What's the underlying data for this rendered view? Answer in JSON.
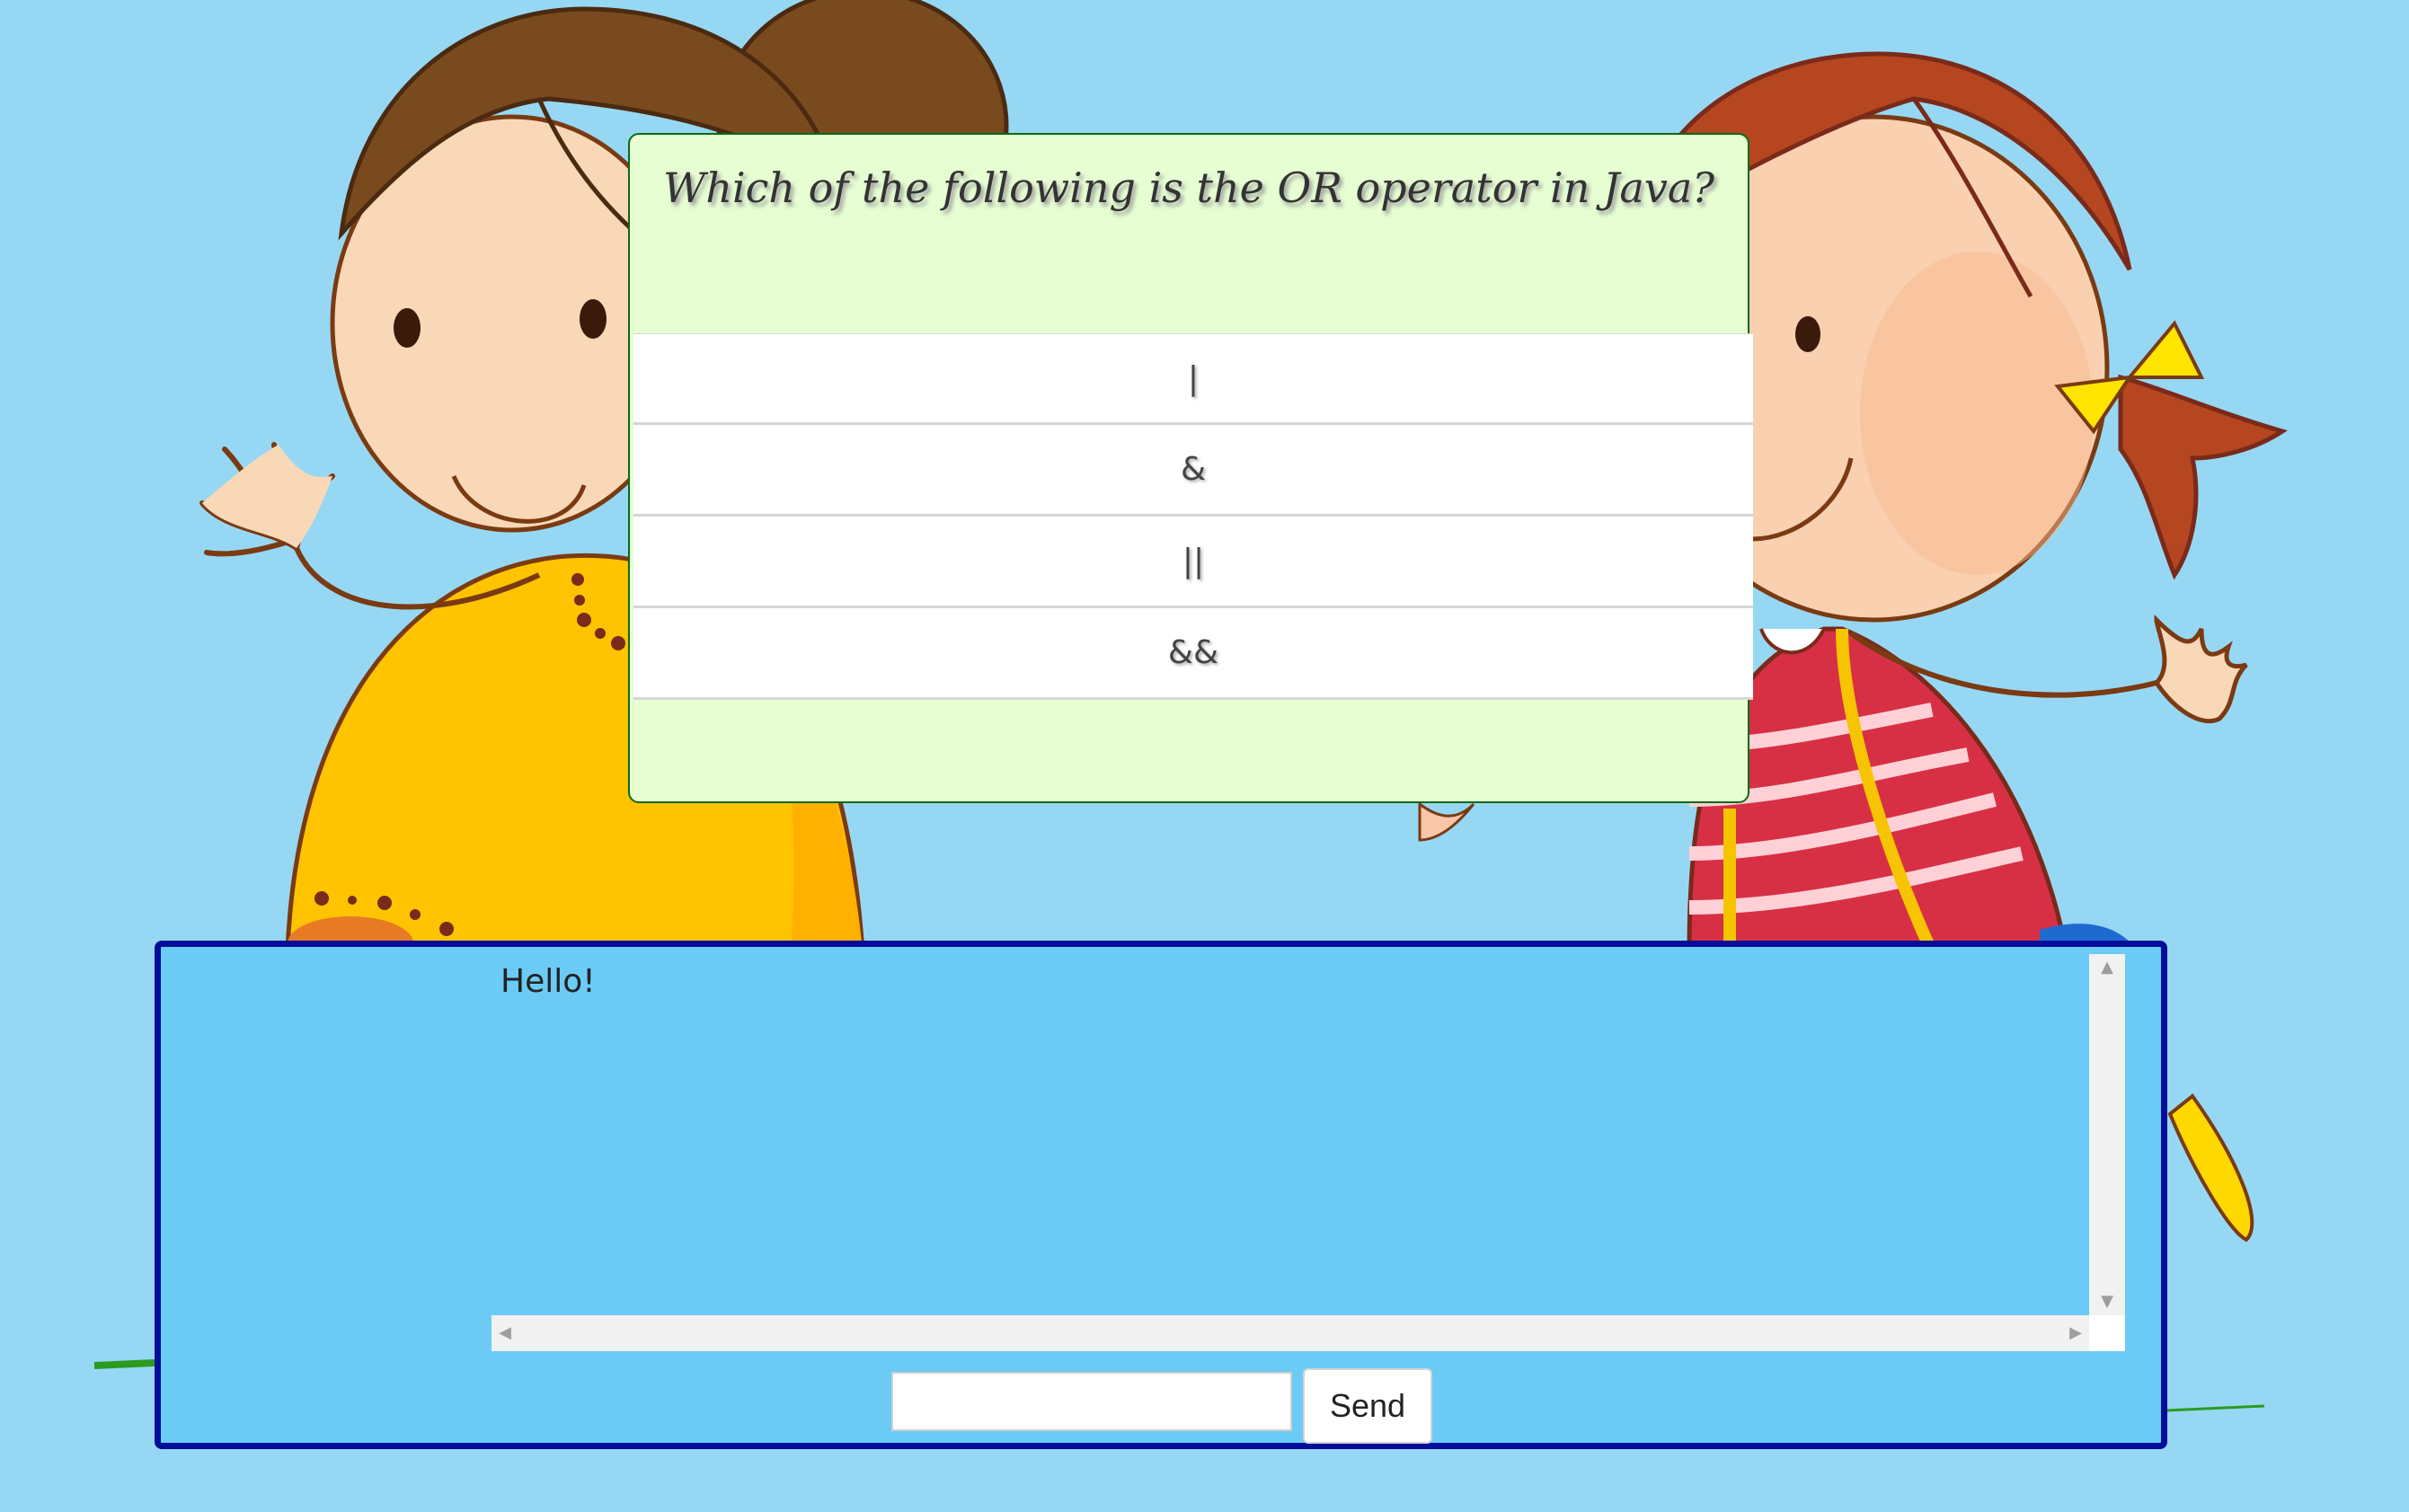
{
  "quiz": {
    "question": "Which of the following is the OR operator in Java?",
    "answers": [
      "|",
      "&",
      "||",
      "&&"
    ]
  },
  "chat": {
    "messages": [
      "Hello!"
    ],
    "input_value": "",
    "send_label": "Send"
  },
  "colors": {
    "background": "#96d8f4",
    "quiz_card": "#e6fed2",
    "quiz_border": "#0b6a16",
    "chat_panel": "#6bcbf5",
    "chat_border": "#020e99"
  }
}
